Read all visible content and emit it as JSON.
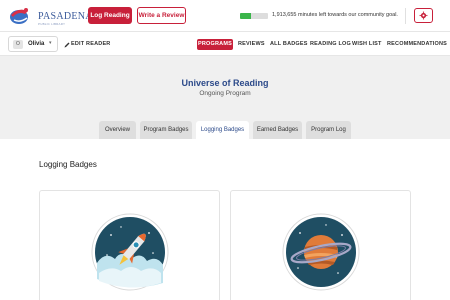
{
  "header": {
    "logo_text": "PASADENA",
    "logo_subtext": "PUBLIC LIBRARY",
    "log_reading_label": "Log Reading",
    "write_review_label": "Write a Review",
    "goal_progress": 0.4,
    "goal_text": "1,913,655 minutes left towards our community goal."
  },
  "reader": {
    "avatar_initial": "O",
    "name": "Olivia",
    "edit_label": "EDIT READER"
  },
  "nav": {
    "items": [
      "PROGRAMS",
      "REVIEWS",
      "ALL BADGES",
      "READING LOG",
      "WISH LIST",
      "RECOMMENDATIONS"
    ],
    "active": "PROGRAMS"
  },
  "program": {
    "title": "Universe of Reading",
    "status": "Ongoing Program"
  },
  "tabs": {
    "items": [
      "Overview",
      "Program Badges",
      "Logging Badges",
      "Earned Badges",
      "Program Log"
    ],
    "active": "Logging Badges"
  },
  "section": {
    "title": "Logging Badges"
  },
  "badges": [
    {
      "icon": "rocket-icon"
    },
    {
      "icon": "planet-icon"
    }
  ],
  "colors": {
    "accent": "#c8203a",
    "title_blue": "#2c4a8a",
    "progress_green": "#3bb54a"
  }
}
